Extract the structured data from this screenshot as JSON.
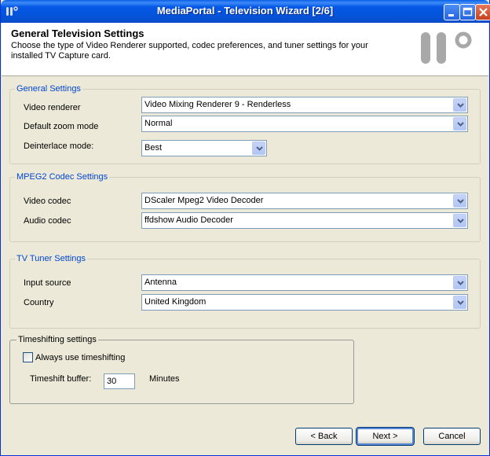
{
  "window": {
    "title": "MediaPortal - Television Wizard [2/6]",
    "app_icon": "mediaportal-icon",
    "controls": {
      "minimize": "minimize-icon",
      "maximize": "maximize-icon",
      "close": "close-icon"
    }
  },
  "header": {
    "title": "General Television Settings",
    "description": "Choose the type of Video Renderer supported, codec preferences, and tuner settings for your installed TV Capture card.",
    "logo": "mediaportal-logo"
  },
  "general_settings": {
    "legend": "General Settings",
    "video_renderer_label": "Video renderer",
    "video_renderer_value": "Video Mixing Renderer 9 - Renderless",
    "zoom_label": "Default zoom mode",
    "zoom_value": "Normal",
    "deinterlace_label": "Deinterlace mode:",
    "deinterlace_value": "Best"
  },
  "mpeg2": {
    "legend": "MPEG2 Codec Settings",
    "video_codec_label": "Video codec",
    "video_codec_value": "DScaler Mpeg2 Video Decoder",
    "audio_codec_label": "Audio codec",
    "audio_codec_value": "ffdshow Audio Decoder"
  },
  "tuner": {
    "legend": "TV Tuner Settings",
    "input_label": "Input source",
    "input_value": "Antenna",
    "country_label": "Country",
    "country_value": "United Kingdom"
  },
  "timeshift": {
    "legend": "Timeshifting settings",
    "always_label": "Always use timeshifting",
    "always_checked": false,
    "buffer_label": "Timeshift buffer:",
    "buffer_value": "30",
    "unit": "Minutes"
  },
  "buttons": {
    "back": "< Back",
    "next": "Next >",
    "cancel": "Cancel"
  },
  "colors": {
    "title_bar": "#0558e6",
    "group_legend": "#0046d5",
    "face": "#ece9d8"
  }
}
